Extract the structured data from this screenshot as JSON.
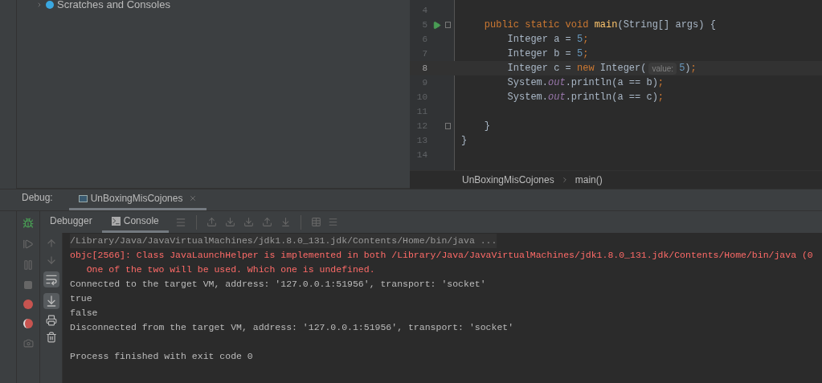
{
  "project_tree": {
    "items": [
      {
        "label": "Scratches and Consoles",
        "expanded": false
      }
    ]
  },
  "editor": {
    "lines": [
      {
        "number": "4",
        "current": false,
        "run": false,
        "fold": false
      },
      {
        "number": "5",
        "current": false,
        "run": true,
        "fold": true,
        "tokens": [
          {
            "text": "    public static void ",
            "kind": "kw"
          },
          {
            "text": "main",
            "kind": "decl"
          },
          {
            "text": "(String[] args) {",
            "kind": "plain"
          }
        ]
      },
      {
        "number": "6",
        "current": false,
        "run": false,
        "fold": false,
        "tokens": [
          {
            "text": "        Integer a = ",
            "kind": "plain"
          },
          {
            "text": "5",
            "kind": "num"
          },
          {
            "text": ";",
            "kind": "punct"
          }
        ]
      },
      {
        "number": "7",
        "current": false,
        "run": false,
        "fold": false,
        "tokens": [
          {
            "text": "        Integer b = ",
            "kind": "plain"
          },
          {
            "text": "5",
            "kind": "num"
          },
          {
            "text": ";",
            "kind": "punct"
          }
        ]
      },
      {
        "number": "8",
        "current": true,
        "run": false,
        "fold": false,
        "tokens": [
          {
            "text": "        Integer c = ",
            "kind": "plain"
          },
          {
            "text": "new ",
            "kind": "kw"
          },
          {
            "text": "Integer(",
            "kind": "plain"
          },
          {
            "text": "value:",
            "kind": "hint"
          },
          {
            "text": "5",
            "kind": "num"
          },
          {
            "text": ")",
            "kind": "plain"
          },
          {
            "text": ";",
            "kind": "punct"
          }
        ]
      },
      {
        "number": "9",
        "current": false,
        "run": false,
        "fold": false,
        "tokens": [
          {
            "text": "        System.",
            "kind": "plain"
          },
          {
            "text": "out",
            "kind": "field"
          },
          {
            "text": ".println(a == b)",
            "kind": "plain"
          },
          {
            "text": ";",
            "kind": "punct"
          }
        ]
      },
      {
        "number": "10",
        "current": false,
        "run": false,
        "fold": false,
        "tokens": [
          {
            "text": "        System.",
            "kind": "plain"
          },
          {
            "text": "out",
            "kind": "field"
          },
          {
            "text": ".println(a == c)",
            "kind": "plain"
          },
          {
            "text": ";",
            "kind": "punct"
          }
        ]
      },
      {
        "number": "11",
        "current": false,
        "run": false,
        "fold": false
      },
      {
        "number": "12",
        "current": false,
        "run": false,
        "fold": true,
        "tokens": [
          {
            "text": "    }",
            "kind": "plain"
          }
        ]
      },
      {
        "number": "13",
        "current": false,
        "run": false,
        "fold": false,
        "tokens": [
          {
            "text": "}",
            "kind": "plain"
          }
        ]
      },
      {
        "number": "14",
        "current": false,
        "run": false,
        "fold": false
      }
    ],
    "breadcrumbs": [
      "UnBoxingMisCojones",
      "main()"
    ]
  },
  "debug": {
    "label": "Debug:",
    "tabs": [
      {
        "label": "UnBoxingMisCojones",
        "selected": true
      }
    ],
    "subtabs": [
      {
        "label": "Debugger",
        "selected": false
      },
      {
        "label": "Console",
        "selected": true
      }
    ],
    "console": [
      {
        "kind": "command",
        "text": "/Library/Java/JavaVirtualMachines/jdk1.8.0_131.jdk/Contents/Home/bin/java ..."
      },
      {
        "kind": "error",
        "text": "objc[2566]: Class JavaLaunchHelper is implemented in both /Library/Java/JavaVirtualMachines/jdk1.8.0_131.jdk/Contents/Home/bin/java (0"
      },
      {
        "kind": "error",
        "text": "   One of the two will be used. Which one is undefined."
      },
      {
        "kind": "normal",
        "text": "Connected to the target VM, address: '127.0.0.1:51956', transport: 'socket'"
      },
      {
        "kind": "normal",
        "text": "true"
      },
      {
        "kind": "normal",
        "text": "false"
      },
      {
        "kind": "normal",
        "text": "Disconnected from the target VM, address: '127.0.0.1:51956', transport: 'socket'"
      },
      {
        "kind": "blank"
      },
      {
        "kind": "normal",
        "text": "Process finished with exit code 0"
      }
    ]
  }
}
